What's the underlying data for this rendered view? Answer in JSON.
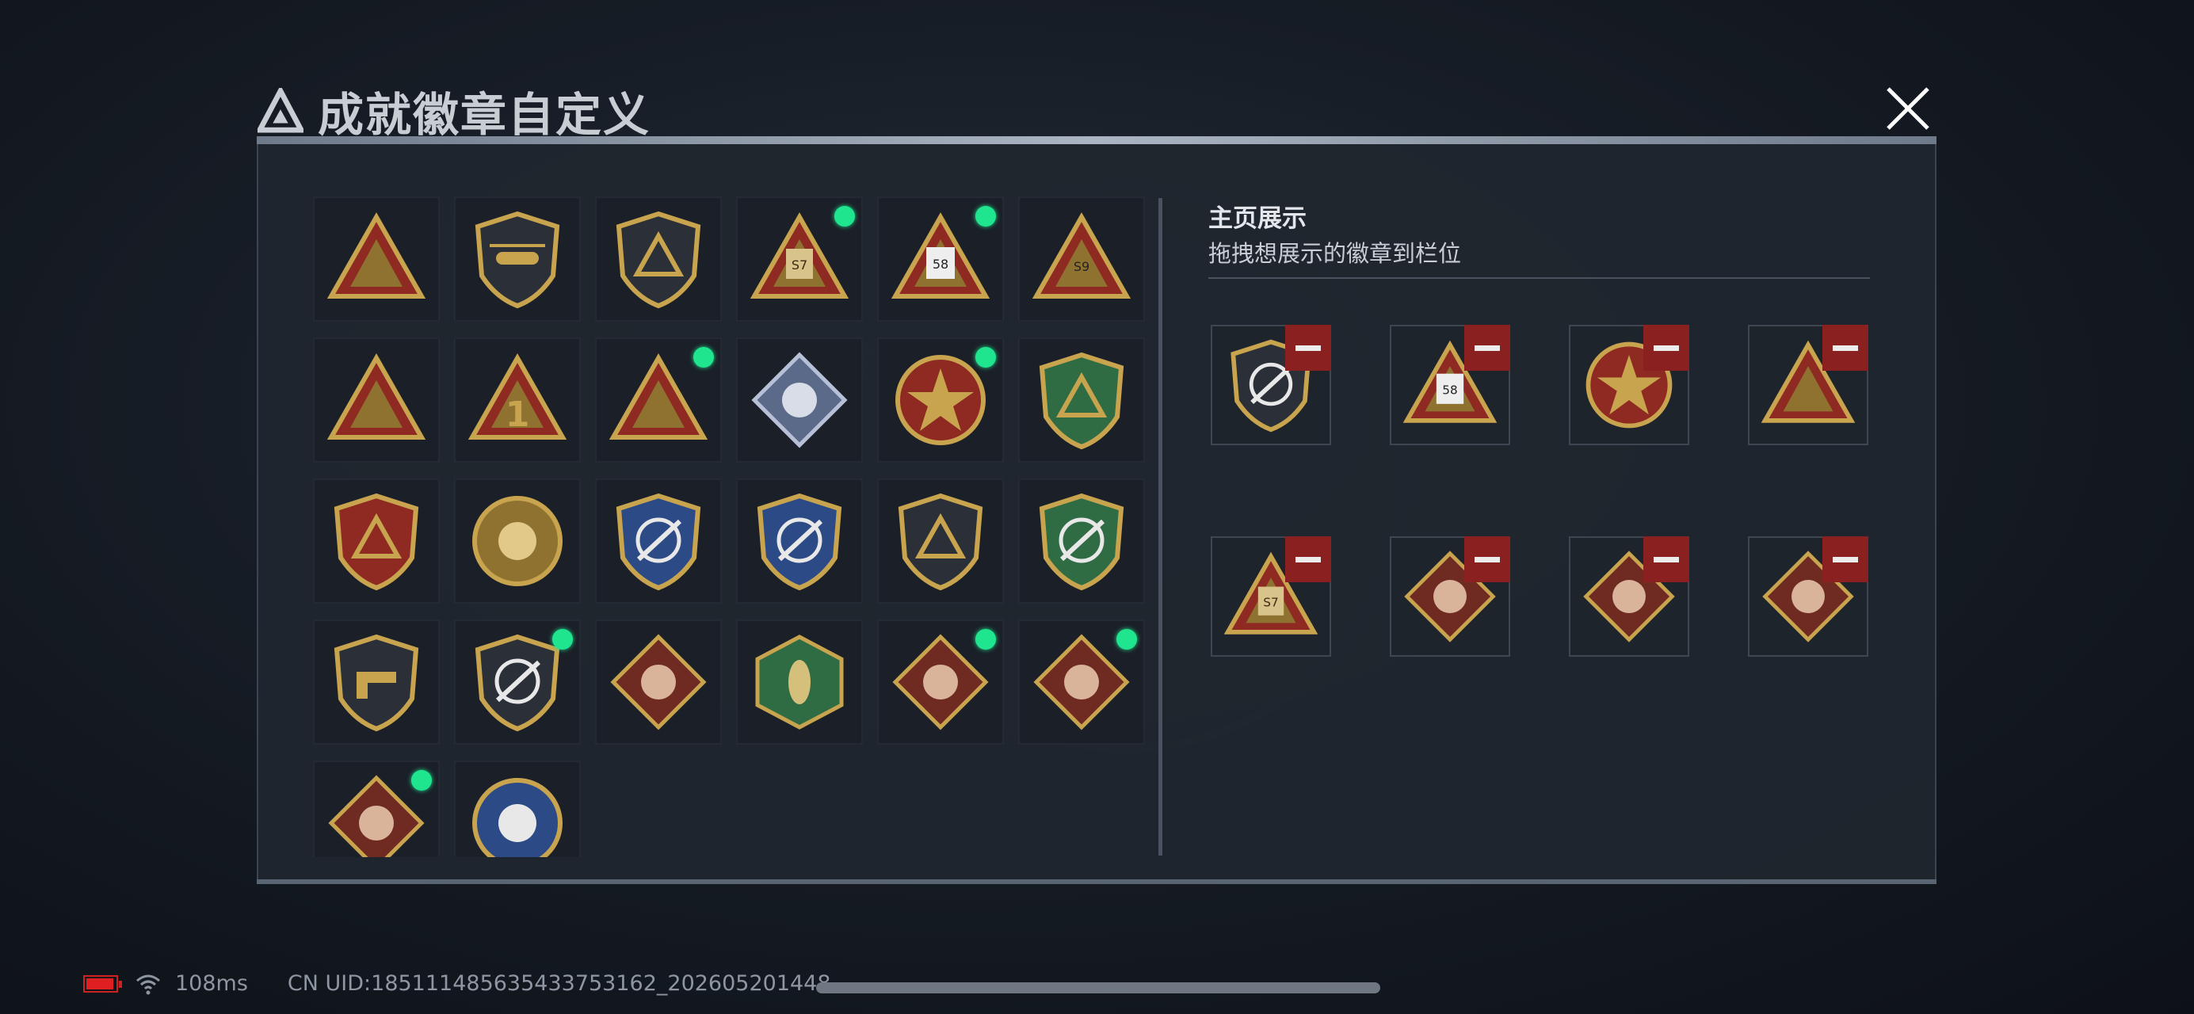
{
  "header": {
    "title": "成就徽章自定义"
  },
  "colors": {
    "accent_green": "#1fe58f",
    "remove_red": "#8a2020",
    "gold": "#c9a44e",
    "panel": "#20262f"
  },
  "badges": [
    {
      "row": 0,
      "col": 0,
      "icon": "gray-shield-triangle-badge-icon",
      "new": false
    },
    {
      "row": 0,
      "col": 1,
      "icon": "helicopter-shield-badge-icon",
      "new": false
    },
    {
      "row": 0,
      "col": 2,
      "icon": "dark-shield-emblem-badge-icon",
      "new": false
    },
    {
      "row": 0,
      "col": 3,
      "icon": "season-s7-triangle-badge-icon",
      "new": true
    },
    {
      "row": 0,
      "col": 4,
      "icon": "season-s8-triangle-badge-icon",
      "new": true
    },
    {
      "row": 0,
      "col": 5,
      "icon": "season-s9-helicopter-triangle-badge-icon",
      "new": false
    },
    {
      "row": 1,
      "col": 0,
      "icon": "gold-wing-triangle-badge-icon",
      "new": false
    },
    {
      "row": 1,
      "col": 1,
      "icon": "number-one-triangle-badge-icon",
      "new": false
    },
    {
      "row": 1,
      "col": 2,
      "icon": "soldiers-triangle-badge-icon",
      "new": true
    },
    {
      "row": 1,
      "col": 3,
      "icon": "rose-diamond-badge-icon",
      "new": false
    },
    {
      "row": 1,
      "col": 4,
      "icon": "red-blue-star-round-badge-icon",
      "new": true
    },
    {
      "row": 1,
      "col": 5,
      "icon": "green-shield-badge-icon",
      "new": false
    },
    {
      "row": 2,
      "col": 0,
      "icon": "star-crest-shield-badge-icon",
      "new": false
    },
    {
      "row": 2,
      "col": 1,
      "icon": "gold-round-emblem-badge-icon",
      "new": false
    },
    {
      "row": 2,
      "col": 2,
      "icon": "blue-crosshair-rifle-shield-icon",
      "new": false
    },
    {
      "row": 2,
      "col": 3,
      "icon": "navy-crosshair-rifle-shield-icon",
      "new": false
    },
    {
      "row": 2,
      "col": 4,
      "icon": "gold-crossed-shield-badge-icon",
      "new": false
    },
    {
      "row": 2,
      "col": 5,
      "icon": "green-crosshair-shield-badge-icon",
      "new": false
    },
    {
      "row": 3,
      "col": 0,
      "icon": "pistol-shield-badge-icon",
      "new": false
    },
    {
      "row": 3,
      "col": 1,
      "icon": "gold-crosshair-shield-badge-icon",
      "new": true
    },
    {
      "row": 3,
      "col": 2,
      "icon": "wolf-diamond-badge-icon",
      "new": false
    },
    {
      "row": 3,
      "col": 3,
      "icon": "hornet-hexagon-badge-icon",
      "new": false
    },
    {
      "row": 3,
      "col": 4,
      "icon": "dragon-diamond-badge-icon",
      "new": true
    },
    {
      "row": 3,
      "col": 5,
      "icon": "dragon-diamond-badge-icon",
      "new": true
    },
    {
      "row": 4,
      "col": 0,
      "icon": "runner-diamond-badge-icon",
      "new": true
    },
    {
      "row": 4,
      "col": 1,
      "icon": "lynx-round-badge-icon",
      "new": false
    }
  ],
  "showcase": {
    "title": "主页展示",
    "subtitle": "拖拽想展示的徽章到栏位",
    "slots": [
      {
        "icon": "gold-crosshair-shield-badge-icon"
      },
      {
        "icon": "season-s8-triangle-badge-icon"
      },
      {
        "icon": "red-blue-star-round-badge-icon"
      },
      {
        "icon": "soldiers-triangle-badge-icon"
      },
      {
        "icon": "season-s7-triangle-badge-icon"
      },
      {
        "icon": "dragon-diamond-badge-icon"
      },
      {
        "icon": "dragon-diamond-badge-icon"
      },
      {
        "icon": "runner-diamond-badge-icon"
      }
    ]
  },
  "status_bar": {
    "ping": "108ms",
    "uid": "CN UID:1851114856354337531​62_202605201448"
  }
}
